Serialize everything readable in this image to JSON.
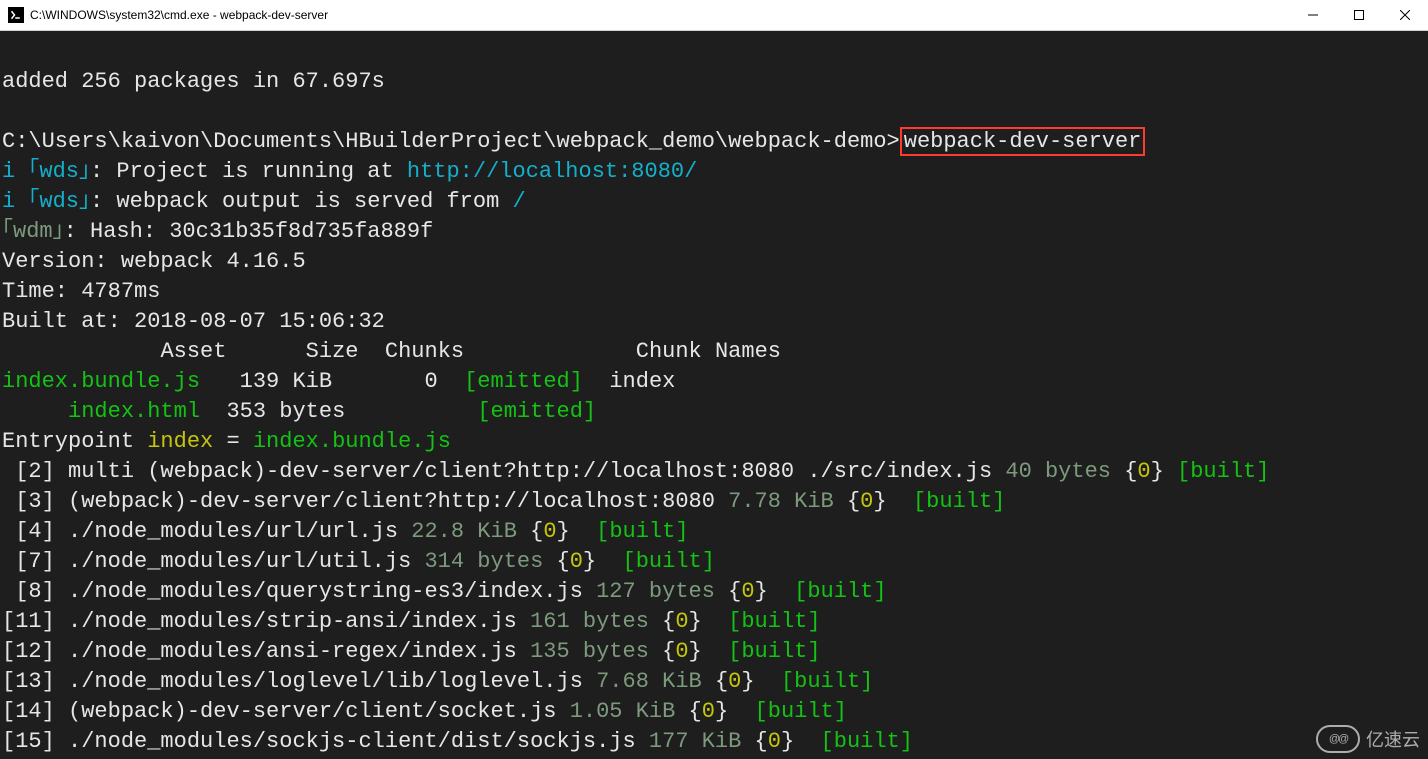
{
  "window": {
    "title": "C:\\WINDOWS\\system32\\cmd.exe - webpack-dev-server"
  },
  "term": {
    "l1": "added 256 packages in 67.697s",
    "prompt": "C:\\Users\\kaivon\\Documents\\HBuilderProject\\webpack_demo\\webpack-demo>",
    "cmd": "webpack-dev-server",
    "wds1_pre": "i ｢wds｣",
    "wds1_txt": ": Project is running at ",
    "wds1_url": "http://localhost:8080/",
    "wds2_pre": "i ｢wds｣",
    "wds2_txt": ": webpack output is served from ",
    "wds2_path": "/",
    "wdm_pre": "｢wdm｣",
    "wdm_label": ": Hash: ",
    "hash": "30c31b35f8d735fa889f",
    "version_label": "Version: webpack ",
    "version": "4.16.5",
    "time_label": "Time: ",
    "time": "4787ms",
    "built_label": "Built at: 2018-08-07 ",
    "built_time": "15:06:32",
    "hdr_asset": "Asset",
    "hdr_size": "Size",
    "hdr_chunks": "Chunks",
    "hdr_chunknames": "Chunk Names",
    "r1_asset": "index.bundle.js",
    "r1_size": "139 KiB",
    "r1_chunks": "0",
    "r1_status": "[emitted]",
    "r1_name": "index",
    "r2_asset": "index.html",
    "r2_size": "353 bytes",
    "r2_status": "[emitted]",
    "entry_label": "Entrypoint ",
    "entry_name": "index",
    "entry_eq": " = ",
    "entry_file": "index.bundle.js",
    "m2": {
      "id": "[2] ",
      "path": "multi (webpack)-dev-server/client?http://localhost:8080 ./src/index.js",
      "size": " 40 bytes ",
      "brace_l": "{",
      "n": "0",
      "brace_r": "}",
      "b": " [built]"
    },
    "m3": {
      "id": "[3] ",
      "path": "(webpack)-dev-server/client?http://localhost:8080",
      "size": " 7.78 KiB ",
      "brace_l": "{",
      "n": "0",
      "brace_r": "}",
      "b": " [built]"
    },
    "m4": {
      "id": "[4] ",
      "path": "./node_modules/url/url.js",
      "size": " 22.8 KiB ",
      "brace_l": "{",
      "n": "0",
      "brace_r": "}",
      "b": " [built]"
    },
    "m7": {
      "id": "[7] ",
      "path": "./node_modules/url/util.js",
      "size": " 314 bytes ",
      "brace_l": "{",
      "n": "0",
      "brace_r": "}",
      "b": " [built]"
    },
    "m8": {
      "id": "[8] ",
      "path": "./node_modules/querystring-es3/index.js",
      "size": " 127 bytes ",
      "brace_l": "{",
      "n": "0",
      "brace_r": "}",
      "b": " [built]"
    },
    "m11": {
      "id": "[11] ",
      "path": "./node_modules/strip-ansi/index.js",
      "size": " 161 bytes ",
      "brace_l": "{",
      "n": "0",
      "brace_r": "}",
      "b": " [built]"
    },
    "m12": {
      "id": "[12] ",
      "path": "./node_modules/ansi-regex/index.js",
      "size": " 135 bytes ",
      "brace_l": "{",
      "n": "0",
      "brace_r": "}",
      "b": " [built]"
    },
    "m13": {
      "id": "[13] ",
      "path": "./node_modules/loglevel/lib/loglevel.js",
      "size": " 7.68 KiB ",
      "brace_l": "{",
      "n": "0",
      "brace_r": "}",
      "b": " [built]"
    },
    "m14": {
      "id": "[14] ",
      "path": "(webpack)-dev-server/client/socket.js",
      "size": " 1.05 KiB ",
      "brace_l": "{",
      "n": "0",
      "brace_r": "}",
      "b": " [built]"
    },
    "m15": {
      "id": "[15] ",
      "path": "./node_modules/sockjs-client/dist/sockjs.js",
      "size": " 177 KiB ",
      "brace_l": "{",
      "n": "0",
      "brace_r": "}",
      "b": " [built]"
    }
  },
  "watermark": "亿速云"
}
